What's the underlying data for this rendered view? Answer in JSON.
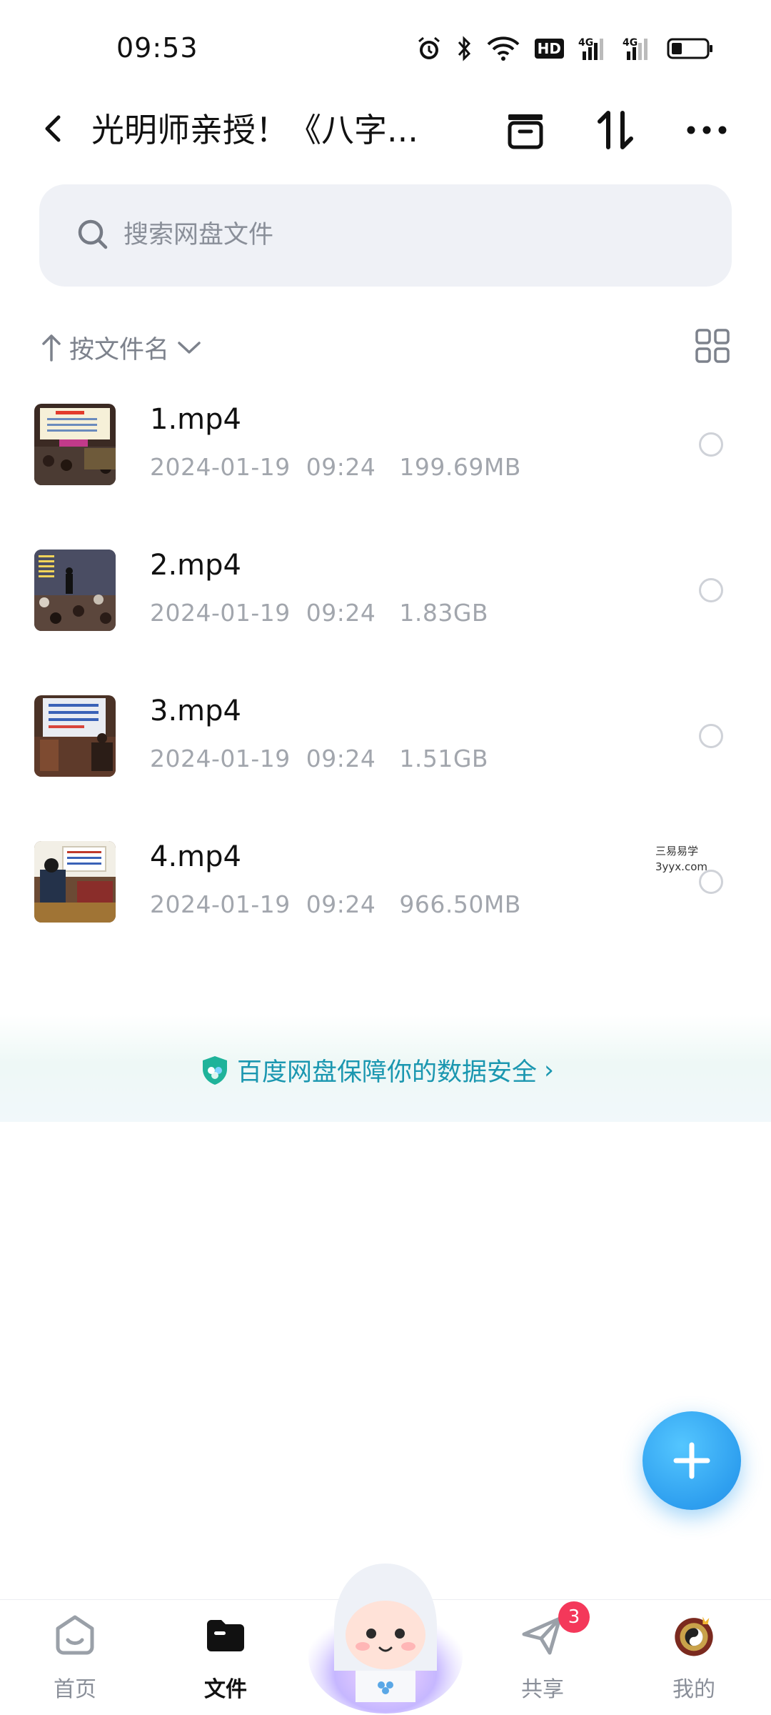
{
  "status_bar": {
    "time": "09:53",
    "icons": [
      "alarm-icon",
      "bluetooth-icon",
      "wifi-icon",
      "hd-icon",
      "signal-4g-icon",
      "signal-4g-icon",
      "battery-icon"
    ],
    "hd_label": "HD",
    "net_label_1": "4G",
    "net_label_2": "4G"
  },
  "header": {
    "title": "光明师亲授！《八字...",
    "actions": [
      "archive-icon",
      "sort-arrows-icon",
      "more-icon"
    ]
  },
  "search": {
    "placeholder": "搜索网盘文件"
  },
  "sort": {
    "label": "按文件名"
  },
  "files": [
    {
      "name": "1.mp4",
      "date": "2024-01-19",
      "time": "09:24",
      "size": "199.69MB"
    },
    {
      "name": "2.mp4",
      "date": "2024-01-19",
      "time": "09:24",
      "size": "1.83GB"
    },
    {
      "name": "3.mp4",
      "date": "2024-01-19",
      "time": "09:24",
      "size": "1.51GB"
    },
    {
      "name": "4.mp4",
      "date": "2024-01-19",
      "time": "09:24",
      "size": "966.50MB"
    }
  ],
  "watermark": {
    "line1": "三易易学",
    "line2": "3yyx.com"
  },
  "security": {
    "text": "百度网盘保障你的数据安全",
    "chevron": "›"
  },
  "tabs": [
    {
      "label": "首页",
      "icon": "home-icon"
    },
    {
      "label": "文件",
      "icon": "folder-icon",
      "active": true
    },
    {
      "label": "共享",
      "icon": "send-icon",
      "badge": "3"
    },
    {
      "label": "我的",
      "icon": "avatar-icon"
    }
  ],
  "colors": {
    "accent": "#2e9fef",
    "security_text": "#1b97b0",
    "badge": "#f4385a"
  }
}
